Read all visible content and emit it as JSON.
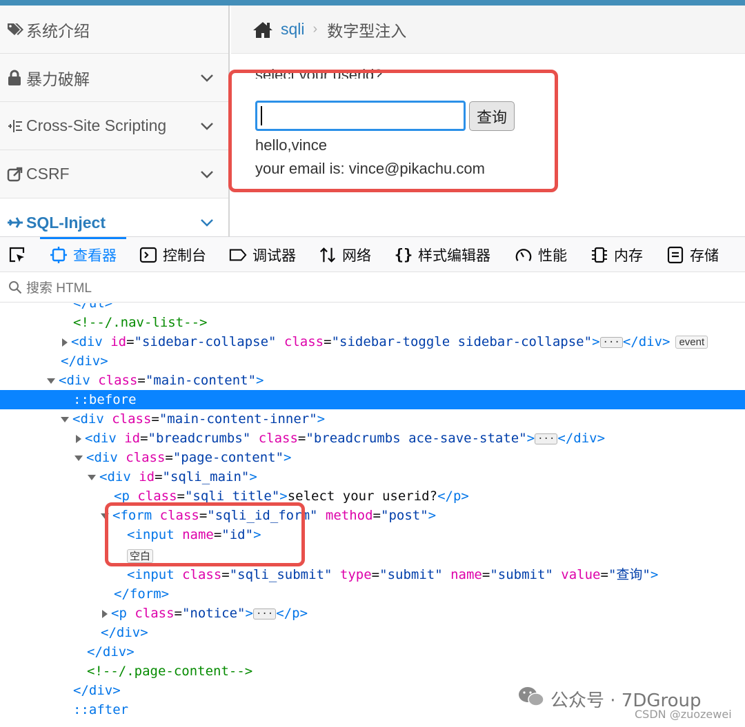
{
  "sidebar": {
    "items": [
      {
        "icon": "tags-icon",
        "label": "系统介绍",
        "expandable": false
      },
      {
        "icon": "lock-icon",
        "label": "暴力破解",
        "expandable": true
      },
      {
        "icon": "list-icon",
        "label": "Cross-Site Scripting",
        "expandable": true
      },
      {
        "icon": "share-icon",
        "label": "CSRF",
        "expandable": true
      },
      {
        "icon": "plane-icon",
        "label": "SQL-Inject",
        "expandable": true,
        "active": true
      }
    ]
  },
  "breadcrumbs": {
    "home_icon": "home-icon",
    "link": "sqli",
    "current": "数字型注入"
  },
  "content": {
    "title": "select your userid?",
    "input_value": "",
    "button_label": "查询",
    "notice_line1": "hello,vince",
    "notice_line2": "your email is: vince@pikachu.com"
  },
  "devtools": {
    "tabs": [
      {
        "icon": "picker-icon",
        "label": ""
      },
      {
        "icon": "inspector-icon",
        "label": "查看器",
        "selected": true
      },
      {
        "icon": "console-icon",
        "label": "控制台"
      },
      {
        "icon": "debugger-icon",
        "label": "调试器"
      },
      {
        "icon": "network-icon",
        "label": "网络"
      },
      {
        "icon": "style-editor-icon",
        "label": "样式编辑器"
      },
      {
        "icon": "performance-icon",
        "label": "性能"
      },
      {
        "icon": "memory-icon",
        "label": "内存"
      },
      {
        "icon": "storage-icon",
        "label": "存储"
      }
    ],
    "search_placeholder": "搜索 HTML",
    "badge_event": "event",
    "badge_empty": "空白",
    "markup": {
      "l0": "</ul>",
      "l1": "<!--/.nav-list-->",
      "l2_tag_open": "<div ",
      "l2_a1n": "id",
      "l2_a1v": "\"sidebar-collapse\"",
      "l2_a2n": "class",
      "l2_a2v": "\"sidebar-toggle sidebar-collapse\"",
      "l2_close": "</div>",
      "l3": "</div>",
      "l4_tag": "<div ",
      "l4_an": "class",
      "l4_av": "\"main-content\"",
      "l5": "::before",
      "l6_tag": "<div ",
      "l6_an": "class",
      "l6_av": "\"main-content-inner\"",
      "l7_tag": "<div ",
      "l7_a1n": "id",
      "l7_a1v": "\"breadcrumbs\"",
      "l7_a2n": "class",
      "l7_a2v": "\"breadcrumbs ace-save-state\"",
      "l7_close": "</div>",
      "l8_tag": "<div ",
      "l8_an": "class",
      "l8_av": "\"page-content\"",
      "l9_tag": "<div ",
      "l9_an": "id",
      "l9_av": "\"sqli_main\"",
      "l10_tag": "<p ",
      "l10_an": "class",
      "l10_av": "\"sqli_title\"",
      "l10_text": "select your userid?",
      "l10_close": "</p>",
      "l11_tag": "<form ",
      "l11_a1n": "class",
      "l11_a1v": "\"sqli_id_form\"",
      "l11_a2n": "method",
      "l11_a2v": "\"post\"",
      "l12_tag": "<input ",
      "l12_an": "name",
      "l12_av": "\"id\"",
      "l14_tag": "<input ",
      "l14_a1n": "class",
      "l14_a1v": "\"sqli_submit\"",
      "l14_a2n": "type",
      "l14_a2v": "\"submit\"",
      "l14_a3n": "name",
      "l14_a3v": "\"submit\"",
      "l14_a4n": "value",
      "l14_a4v": "\"查询\"",
      "l15": "</form>",
      "l16_tag": "<p ",
      "l16_an": "class",
      "l16_av": "\"notice\"",
      "l16_close": "</p>",
      "l17": "</div>",
      "l18": "</div>",
      "l19": "<!--/.page-content-->",
      "l20": "</div>",
      "l21": "::after"
    }
  },
  "watermark": {
    "text": "公众号 · 7DGroup",
    "sub": "CSDN @zuozewei"
  },
  "colors": {
    "accent": "#2b7dbc",
    "devtools_blue": "#0a84ff",
    "annotation_red": "#e8504b"
  }
}
